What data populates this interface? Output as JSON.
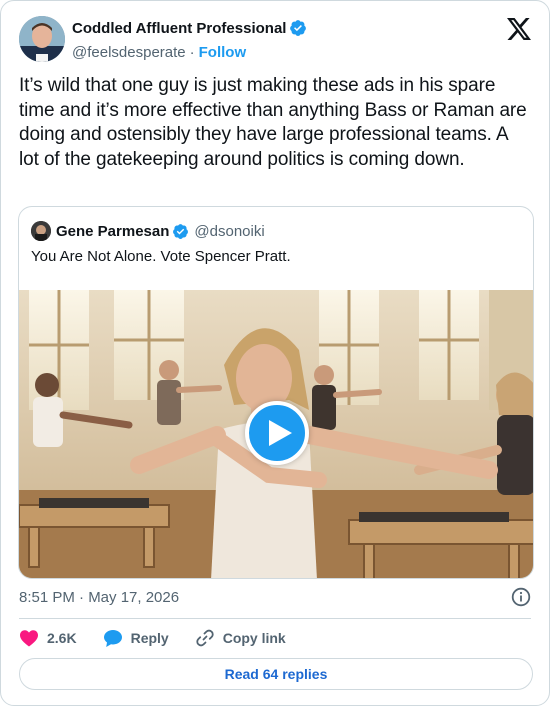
{
  "author": {
    "display_name": "Coddled Affluent Professional",
    "handle": "@feelsdesperate",
    "separator": "·",
    "follow_label": "Follow",
    "verified": true
  },
  "tweet": {
    "text": "It’s wild that one guy is just making these ads in his spare time and it’s more effective than anything Bass or Raman are doing and ostensibly they have large professional teams. A lot of the gatekeeping around politics is coming down."
  },
  "quote": {
    "display_name": "Gene Parmesan",
    "handle": "@dsonoiki",
    "verified": true,
    "text": "You Are Not Alone. Vote Spencer Pratt."
  },
  "timestamp": "8:51 PM · May 17, 2026",
  "actions": {
    "like_count": "2.6K",
    "reply_label": "Reply",
    "copy_label": "Copy link"
  },
  "read_replies_label": "Read 64 replies",
  "colors": {
    "accent": "#1d9bf0",
    "like": "#f91880",
    "muted": "#536471",
    "border": "#cfd9de"
  },
  "icons": [
    "verified-badge-icon",
    "x-logo-icon",
    "play-icon",
    "info-icon",
    "heart-icon",
    "reply-bubble-icon",
    "link-icon"
  ]
}
